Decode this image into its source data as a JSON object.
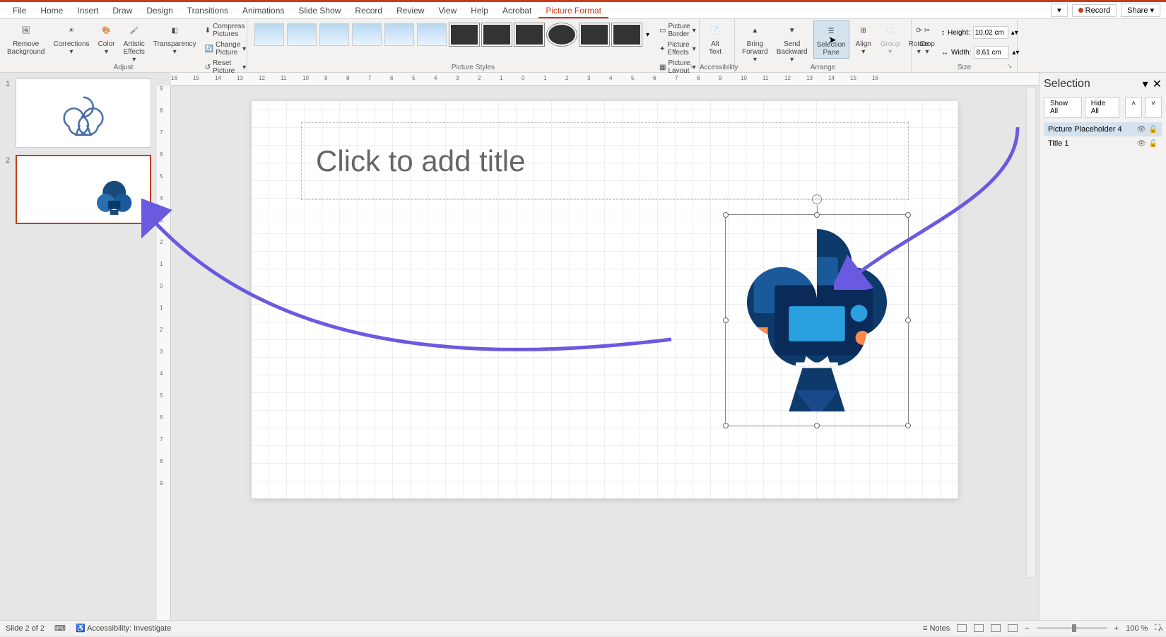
{
  "menus": {
    "file": "File",
    "home": "Home",
    "insert": "Insert",
    "draw": "Draw",
    "design": "Design",
    "transitions": "Transitions",
    "animations": "Animations",
    "slideshow": "Slide Show",
    "record_tab": "Record",
    "review": "Review",
    "view": "View",
    "help": "Help",
    "acrobat": "Acrobat",
    "picture_format": "Picture Format",
    "record_btn": "Record",
    "share_btn": "Share"
  },
  "ribbon": {
    "adjust": {
      "label": "Adjust",
      "remove_bg": "Remove\nBackground",
      "corrections": "Corrections",
      "color": "Color",
      "artistic": "Artistic\nEffects",
      "transparency": "Transparency",
      "compress": "Compress Pictures",
      "change": "Change Picture",
      "reset": "Reset Picture"
    },
    "styles": {
      "label": "Picture Styles",
      "border": "Picture Border",
      "effects": "Picture Effects",
      "layout": "Picture Layout"
    },
    "accessibility": {
      "label": "Accessibility",
      "alt_text": "Alt\nText"
    },
    "arrange": {
      "label": "Arrange",
      "bring_fwd": "Bring\nForward",
      "send_back": "Send\nBackward",
      "sel_pane": "Selection\nPane",
      "align": "Align",
      "group": "Group",
      "rotate": "Rotate"
    },
    "size": {
      "label": "Size",
      "crop": "Crop",
      "height_label": "Height:",
      "height_val": "10,02 cm",
      "width_label": "Width:",
      "width_val": "8,61 cm"
    }
  },
  "ruler_h": [
    "16",
    "15",
    "14",
    "13",
    "12",
    "11",
    "10",
    "9",
    "8",
    "7",
    "6",
    "5",
    "4",
    "3",
    "2",
    "1",
    "0",
    "1",
    "2",
    "3",
    "4",
    "5",
    "6",
    "7",
    "8",
    "9",
    "10",
    "11",
    "12",
    "13",
    "14",
    "15",
    "16"
  ],
  "ruler_v": [
    "9",
    "8",
    "7",
    "6",
    "5",
    "4",
    "3",
    "2",
    "1",
    "0",
    "1",
    "2",
    "3",
    "4",
    "5",
    "6",
    "7",
    "8",
    "9"
  ],
  "slides": {
    "n1": "1",
    "n2": "2"
  },
  "canvas": {
    "title_placeholder": "Click to add title"
  },
  "selection_pane": {
    "title": "Selection",
    "show_all": "Show All",
    "hide_all": "Hide All",
    "items": [
      {
        "name": "Picture Placeholder 4",
        "selected": true
      },
      {
        "name": "Title 1",
        "selected": false
      }
    ]
  },
  "status": {
    "slide_info": "Slide 2 of 2",
    "accessibility": "Accessibility: Investigate",
    "notes": "Notes",
    "zoom": "100 %"
  }
}
